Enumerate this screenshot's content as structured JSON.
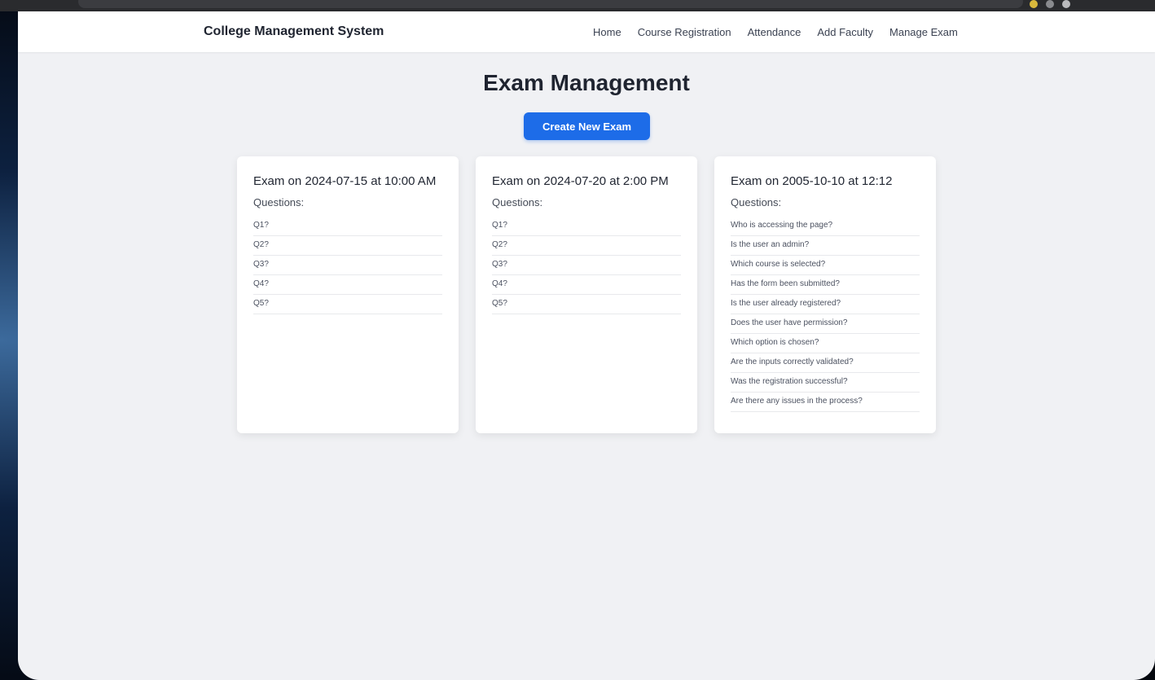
{
  "app": {
    "brand": "College Management System",
    "nav": [
      "Home",
      "Course Registration",
      "Attendance",
      "Add Faculty",
      "Manage Exam"
    ]
  },
  "main": {
    "title": "Exam Management",
    "create_button": "Create New Exam",
    "questions_label": "Questions:",
    "exams": [
      {
        "title": "Exam on 2024-07-15 at 10:00 AM",
        "questions": [
          "Q1?",
          "Q2?",
          "Q3?",
          "Q4?",
          "Q5?"
        ]
      },
      {
        "title": "Exam on 2024-07-20 at 2:00 PM",
        "questions": [
          "Q1?",
          "Q2?",
          "Q3?",
          "Q4?",
          "Q5?"
        ]
      },
      {
        "title": "Exam on 2005-10-10 at 12:12",
        "questions": [
          "Who is accessing the page?",
          "Is the user an admin?",
          "Which course is selected?",
          "Has the form been submitted?",
          "Is the user already registered?",
          "Does the user have permission?",
          "Which option is chosen?",
          "Are the inputs correctly validated?",
          "Was the registration successful?",
          "Are there any issues in the process?"
        ]
      }
    ]
  },
  "colors": {
    "accent": "#1d6ce8",
    "page_bg": "#f0f1f4",
    "card_bg": "#ffffff"
  }
}
